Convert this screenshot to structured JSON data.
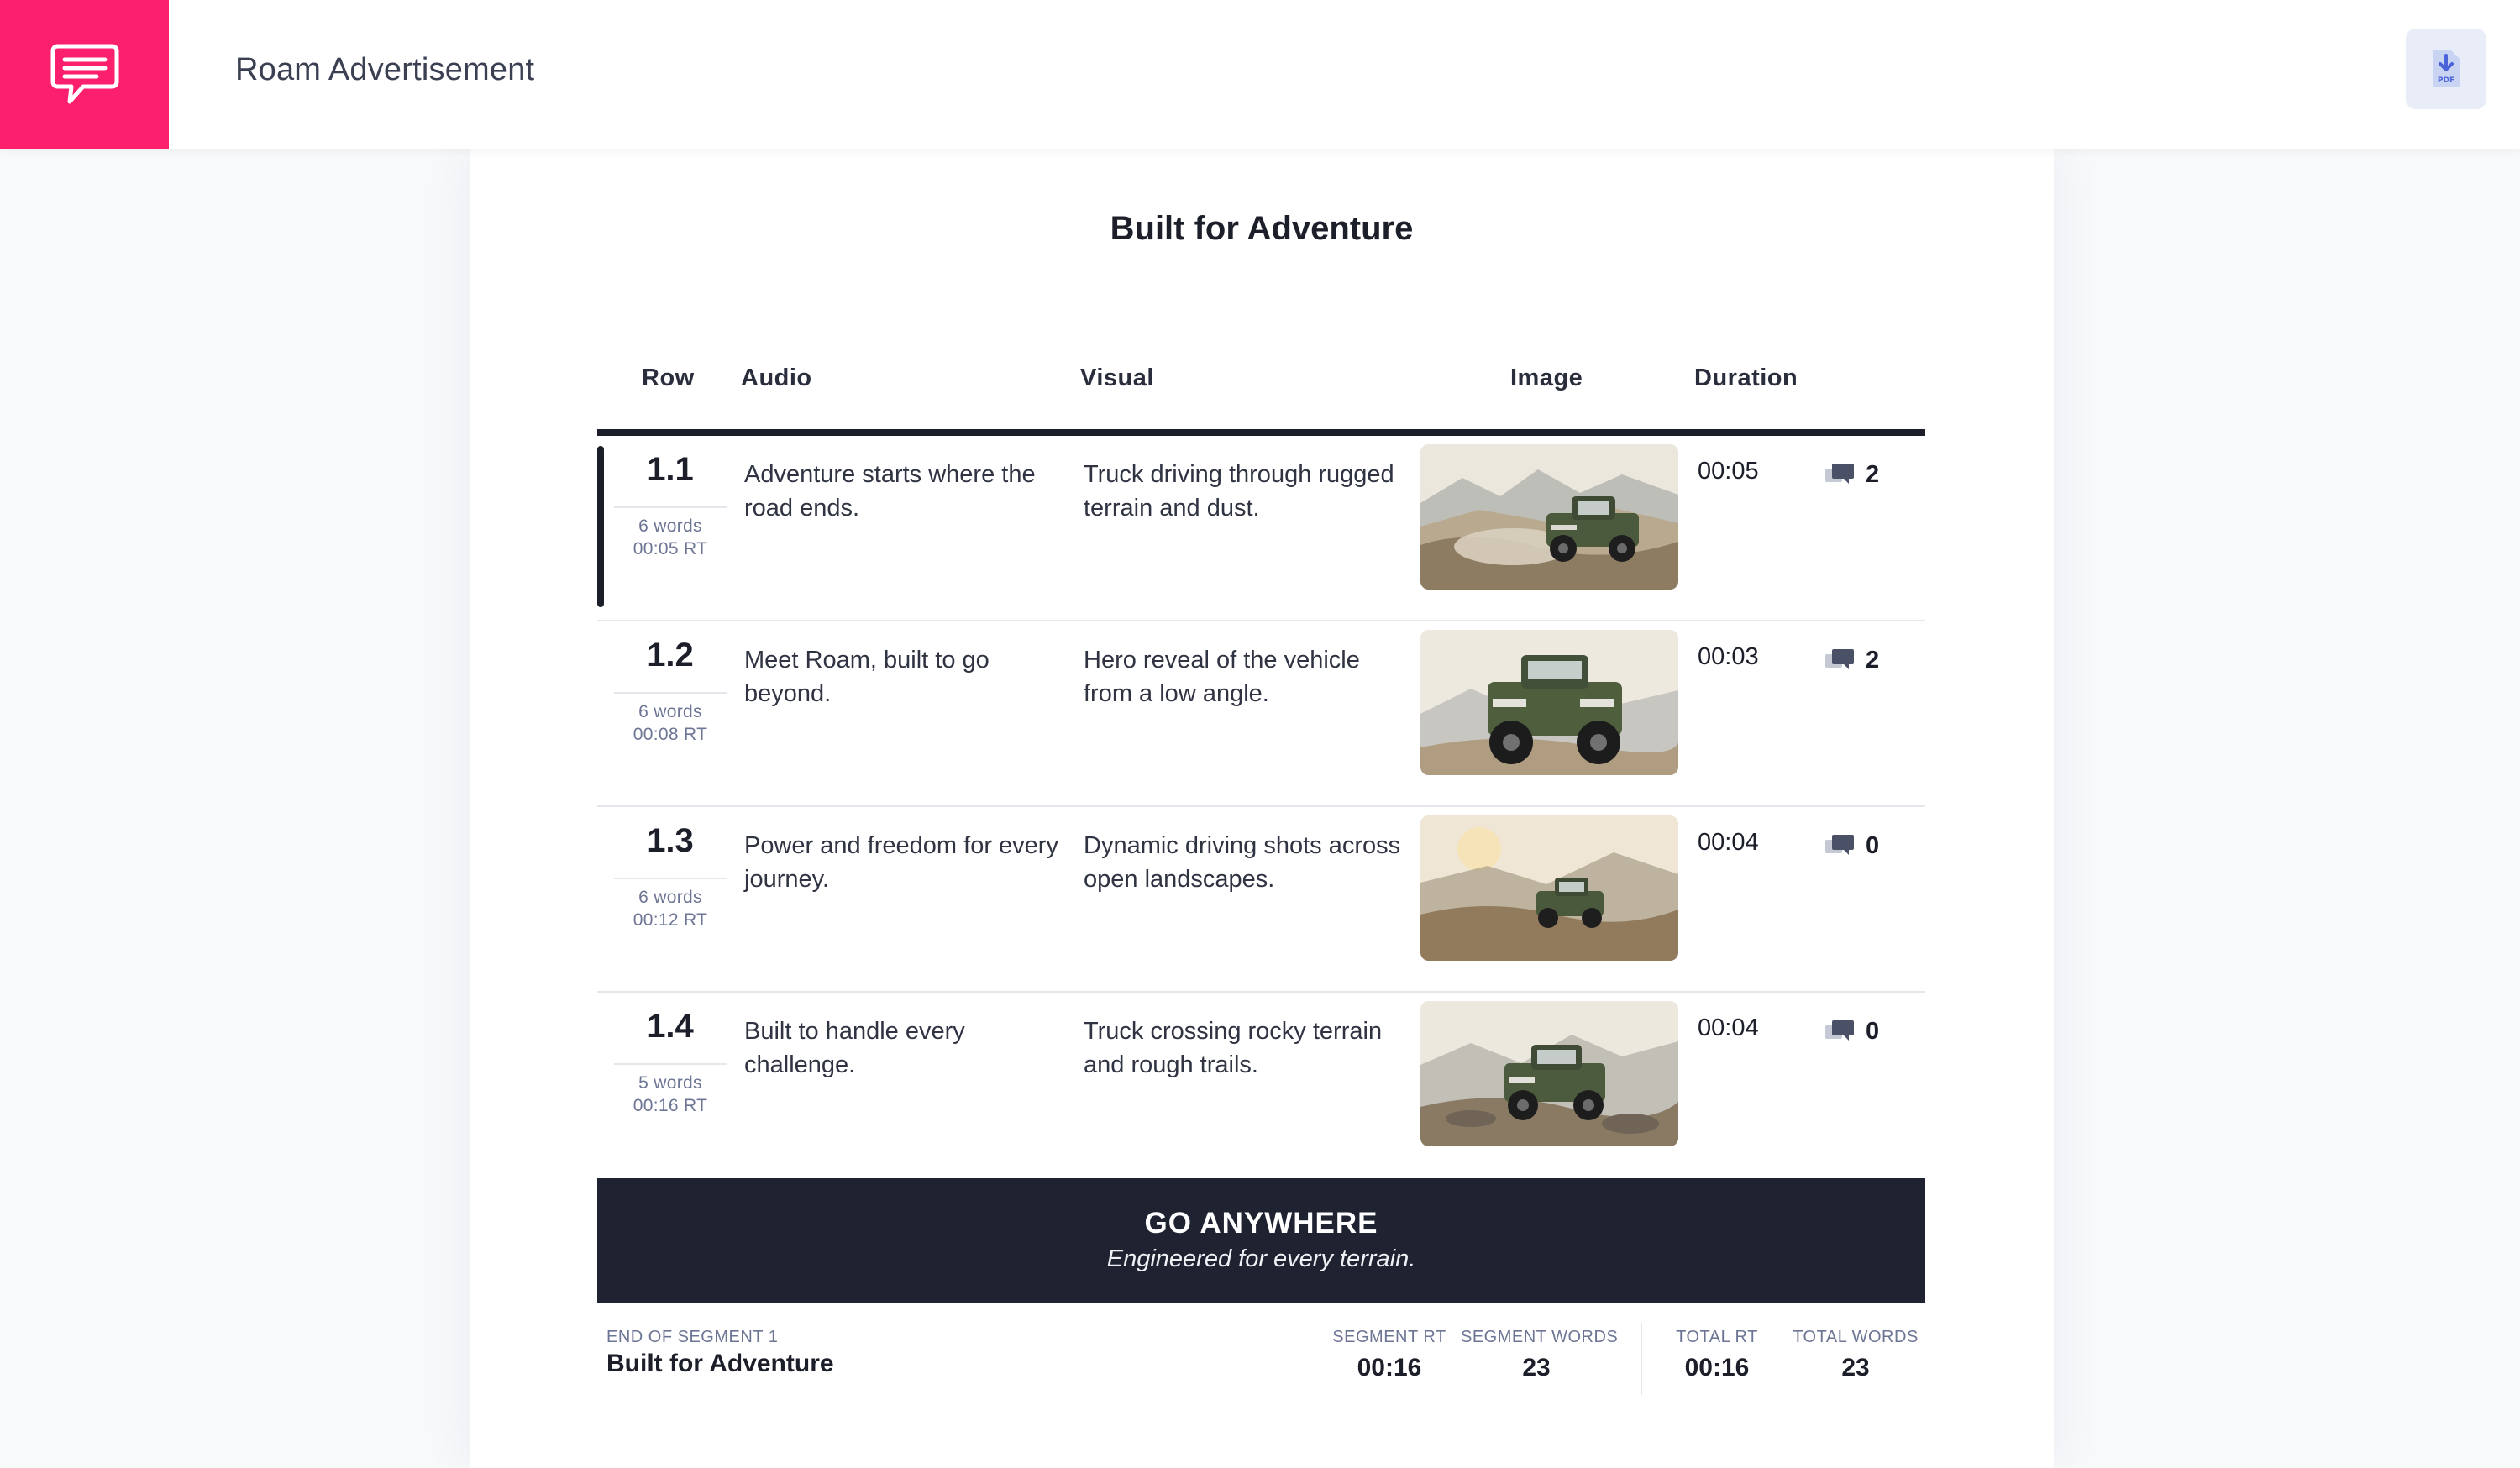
{
  "app": {
    "title": "Roam Advertisement",
    "brand_color": "#fb1f6d",
    "logo_icon": "chat-bubble-icon",
    "pdf_label": "PDF"
  },
  "document": {
    "title": "Built for Adventure",
    "columns": [
      "Row",
      "Audio",
      "Visual",
      "Image",
      "Duration"
    ],
    "rows": [
      {
        "num": "1.1",
        "words": "6 words",
        "rt": "00:05 RT",
        "audio": "Adventure starts where the road ends.",
        "visual": "Truck driving through rugged terrain and dust.",
        "duration": "00:05",
        "comments": "2",
        "active": true
      },
      {
        "num": "1.2",
        "words": "6 words",
        "rt": "00:08 RT",
        "audio": "Meet Roam, built to go beyond.",
        "visual": "Hero reveal of the vehicle from a low angle.",
        "duration": "00:03",
        "comments": "2",
        "active": false
      },
      {
        "num": "1.3",
        "words": "6 words",
        "rt": "00:12 RT",
        "audio": "Power and freedom for every journey.",
        "visual": "Dynamic driving shots across open landscapes.",
        "duration": "00:04",
        "comments": "0",
        "active": false
      },
      {
        "num": "1.4",
        "words": "5 words",
        "rt": "00:16 RT",
        "audio": "Built to handle every challenge.",
        "visual": "Truck crossing rocky terrain and rough trails.",
        "duration": "00:04",
        "comments": "0",
        "active": false
      }
    ],
    "banner": {
      "title": "GO ANYWHERE",
      "subtitle": "Engineered for every terrain."
    },
    "footer": {
      "segment_label": "END OF SEGMENT 1",
      "segment_name": "Built for Adventure",
      "segment_rt_label": "SEGMENT RT",
      "segment_rt": "00:16",
      "segment_words_label": "SEGMENT WORDS",
      "segment_words": "23",
      "total_rt_label": "TOTAL RT",
      "total_rt": "00:16",
      "total_words_label": "TOTAL WORDS",
      "total_words": "23"
    }
  }
}
